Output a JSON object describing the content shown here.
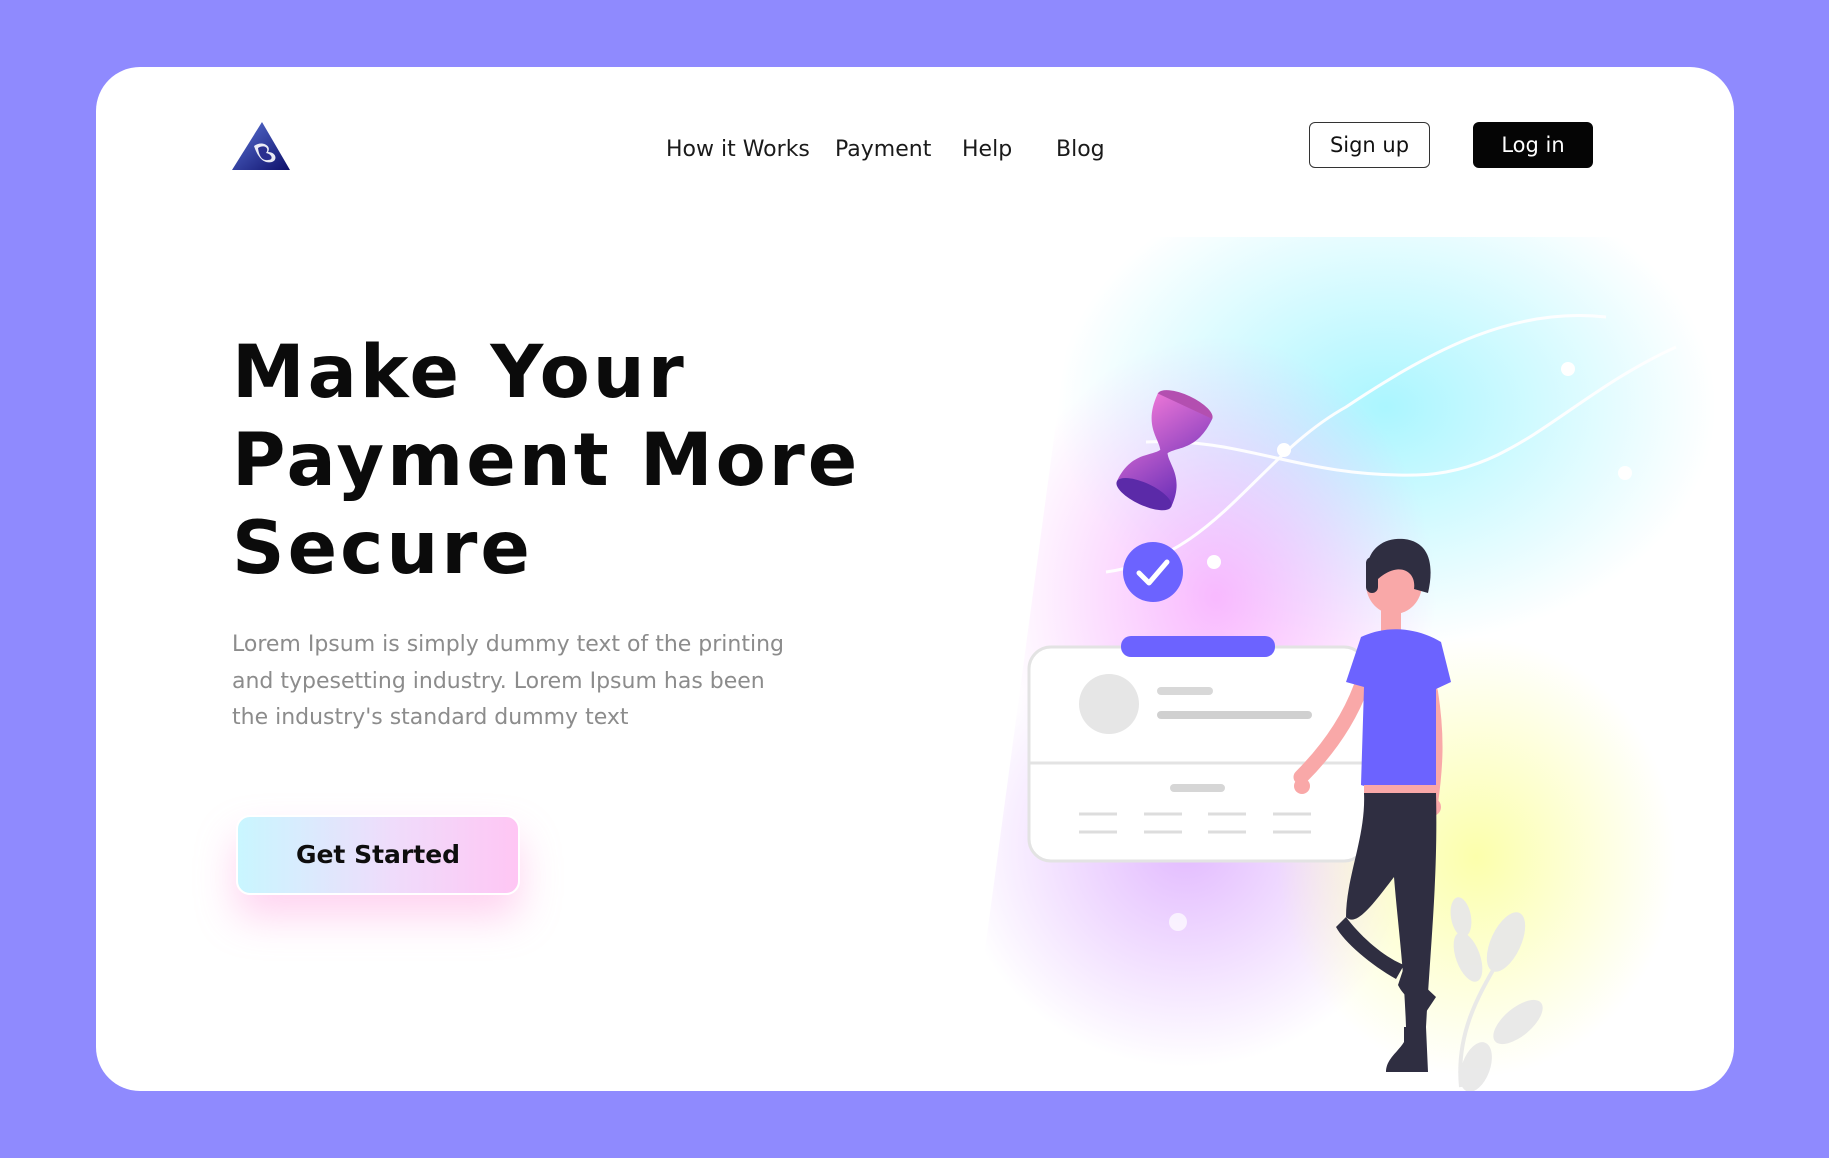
{
  "brand": {
    "logo_icon": "mountain-logo-icon",
    "colors": {
      "background": "#8f8afe",
      "accent": "#6c63ff",
      "dark": "#050505",
      "text_muted": "#8c8c8c"
    }
  },
  "nav": {
    "items": [
      {
        "label": "How it Works"
      },
      {
        "label": "Payment"
      },
      {
        "label": "Help"
      },
      {
        "label": "Blog"
      }
    ],
    "signup_label": "Sign up",
    "login_label": "Log in"
  },
  "hero": {
    "headline_lines": [
      "Make Your",
      "Payment More",
      "Secure"
    ],
    "description": "Lorem Ipsum is simply dummy text of the printing and typesetting industry. Lorem Ipsum has been the industry's standard dummy text",
    "cta_label": "Get Started"
  },
  "illustration": {
    "icons": [
      "hourglass-icon",
      "checkmark-icon",
      "profile-card-icon",
      "woman-figure-icon",
      "plant-icon"
    ]
  }
}
